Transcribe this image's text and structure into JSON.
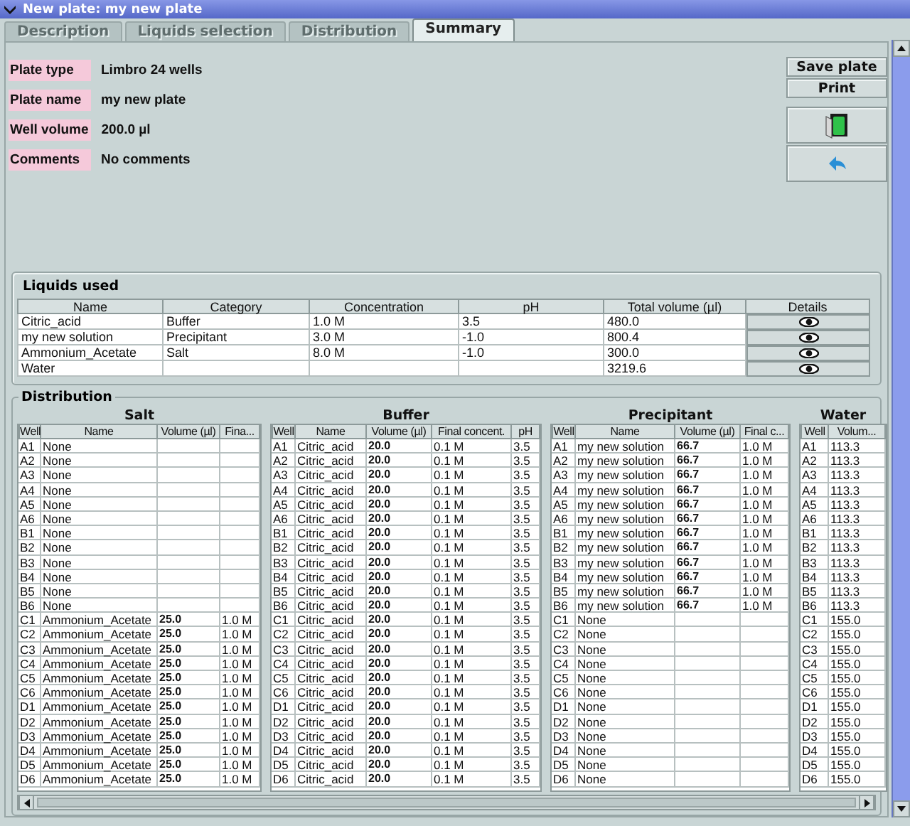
{
  "window": {
    "title": "New plate: my new plate"
  },
  "tabs": [
    {
      "label": "Description",
      "selected": false,
      "disabled": true
    },
    {
      "label": "Liquids selection",
      "selected": false,
      "disabled": true
    },
    {
      "label": "Distribution",
      "selected": false,
      "disabled": true
    },
    {
      "label": "Summary",
      "selected": true,
      "disabled": false
    }
  ],
  "fields": [
    {
      "label": "Plate type",
      "value": "Limbro 24 wells"
    },
    {
      "label": "Plate name",
      "value": "my new plate"
    },
    {
      "label": "Well volume",
      "value": "200.0 µl"
    },
    {
      "label": "Comments",
      "value": "No comments"
    }
  ],
  "buttons": [
    {
      "kind": "text",
      "label": "Save plate"
    },
    {
      "kind": "text",
      "label": "Print"
    },
    {
      "kind": "plate-icon"
    },
    {
      "kind": "back-icon"
    }
  ],
  "liquids_used": {
    "title": "Liquids used",
    "columns": [
      "Name",
      "Category",
      "Concentration",
      "pH",
      "Total volume (µl)",
      "Details"
    ],
    "rows": [
      {
        "name": "Citric_acid",
        "category": "Buffer",
        "concentration": "1.0 M",
        "ph": "3.5",
        "total_volume": "480.0"
      },
      {
        "name": "my new solution",
        "category": "Precipitant",
        "concentration": "3.0 M",
        "ph": "-1.0",
        "total_volume": "800.4"
      },
      {
        "name": "Ammonium_Acetate",
        "category": "Salt",
        "concentration": "8.0 M",
        "ph": "-1.0",
        "total_volume": "300.0"
      },
      {
        "name": "Water",
        "total_volume": "3219.6"
      }
    ]
  },
  "distribution": {
    "title": "Distribution",
    "tables": [
      {
        "title": "Salt",
        "columns": [
          {
            "label": "Well"
          },
          {
            "label": "Name"
          },
          {
            "label": "Volume (µl)",
            "bold": true
          },
          {
            "label": "Fina..."
          }
        ],
        "rows": [
          [
            "A1",
            "None"
          ],
          [
            "A2",
            "None"
          ],
          [
            "A3",
            "None"
          ],
          [
            "A4",
            "None"
          ],
          [
            "A5",
            "None"
          ],
          [
            "A6",
            "None"
          ],
          [
            "B1",
            "None"
          ],
          [
            "B2",
            "None"
          ],
          [
            "B3",
            "None"
          ],
          [
            "B4",
            "None"
          ],
          [
            "B5",
            "None"
          ],
          [
            "B6",
            "None"
          ],
          [
            "C1",
            "Ammonium_Acetate",
            "25.0",
            "1.0 M"
          ],
          [
            "C2",
            "Ammonium_Acetate",
            "25.0",
            "1.0 M"
          ],
          [
            "C3",
            "Ammonium_Acetate",
            "25.0",
            "1.0 M"
          ],
          [
            "C4",
            "Ammonium_Acetate",
            "25.0",
            "1.0 M"
          ],
          [
            "C5",
            "Ammonium_Acetate",
            "25.0",
            "1.0 M"
          ],
          [
            "C6",
            "Ammonium_Acetate",
            "25.0",
            "1.0 M"
          ],
          [
            "D1",
            "Ammonium_Acetate",
            "25.0",
            "1.0 M"
          ],
          [
            "D2",
            "Ammonium_Acetate",
            "25.0",
            "1.0 M"
          ],
          [
            "D3",
            "Ammonium_Acetate",
            "25.0",
            "1.0 M"
          ],
          [
            "D4",
            "Ammonium_Acetate",
            "25.0",
            "1.0 M"
          ],
          [
            "D5",
            "Ammonium_Acetate",
            "25.0",
            "1.0 M"
          ],
          [
            "D6",
            "Ammonium_Acetate",
            "25.0",
            "1.0 M"
          ]
        ]
      },
      {
        "title": "Buffer",
        "columns": [
          {
            "label": "Well"
          },
          {
            "label": "Name"
          },
          {
            "label": "Volume (µl)",
            "bold": true
          },
          {
            "label": "Final concent."
          },
          {
            "label": "pH"
          }
        ],
        "rows": [
          [
            "A1",
            "Citric_acid",
            "20.0",
            "0.1 M",
            "3.5"
          ],
          [
            "A2",
            "Citric_acid",
            "20.0",
            "0.1 M",
            "3.5"
          ],
          [
            "A3",
            "Citric_acid",
            "20.0",
            "0.1 M",
            "3.5"
          ],
          [
            "A4",
            "Citric_acid",
            "20.0",
            "0.1 M",
            "3.5"
          ],
          [
            "A5",
            "Citric_acid",
            "20.0",
            "0.1 M",
            "3.5"
          ],
          [
            "A6",
            "Citric_acid",
            "20.0",
            "0.1 M",
            "3.5"
          ],
          [
            "B1",
            "Citric_acid",
            "20.0",
            "0.1 M",
            "3.5"
          ],
          [
            "B2",
            "Citric_acid",
            "20.0",
            "0.1 M",
            "3.5"
          ],
          [
            "B3",
            "Citric_acid",
            "20.0",
            "0.1 M",
            "3.5"
          ],
          [
            "B4",
            "Citric_acid",
            "20.0",
            "0.1 M",
            "3.5"
          ],
          [
            "B5",
            "Citric_acid",
            "20.0",
            "0.1 M",
            "3.5"
          ],
          [
            "B6",
            "Citric_acid",
            "20.0",
            "0.1 M",
            "3.5"
          ],
          [
            "C1",
            "Citric_acid",
            "20.0",
            "0.1 M",
            "3.5"
          ],
          [
            "C2",
            "Citric_acid",
            "20.0",
            "0.1 M",
            "3.5"
          ],
          [
            "C3",
            "Citric_acid",
            "20.0",
            "0.1 M",
            "3.5"
          ],
          [
            "C4",
            "Citric_acid",
            "20.0",
            "0.1 M",
            "3.5"
          ],
          [
            "C5",
            "Citric_acid",
            "20.0",
            "0.1 M",
            "3.5"
          ],
          [
            "C6",
            "Citric_acid",
            "20.0",
            "0.1 M",
            "3.5"
          ],
          [
            "D1",
            "Citric_acid",
            "20.0",
            "0.1 M",
            "3.5"
          ],
          [
            "D2",
            "Citric_acid",
            "20.0",
            "0.1 M",
            "3.5"
          ],
          [
            "D3",
            "Citric_acid",
            "20.0",
            "0.1 M",
            "3.5"
          ],
          [
            "D4",
            "Citric_acid",
            "20.0",
            "0.1 M",
            "3.5"
          ],
          [
            "D5",
            "Citric_acid",
            "20.0",
            "0.1 M",
            "3.5"
          ],
          [
            "D6",
            "Citric_acid",
            "20.0",
            "0.1 M",
            "3.5"
          ]
        ]
      },
      {
        "title": "Precipitant",
        "columns": [
          {
            "label": "Well"
          },
          {
            "label": "Name"
          },
          {
            "label": "Volume (µl)",
            "bold": true
          },
          {
            "label": "Final c..."
          }
        ],
        "rows": [
          [
            "A1",
            "my new solution",
            "66.7",
            "1.0 M"
          ],
          [
            "A2",
            "my new solution",
            "66.7",
            "1.0 M"
          ],
          [
            "A3",
            "my new solution",
            "66.7",
            "1.0 M"
          ],
          [
            "A4",
            "my new solution",
            "66.7",
            "1.0 M"
          ],
          [
            "A5",
            "my new solution",
            "66.7",
            "1.0 M"
          ],
          [
            "A6",
            "my new solution",
            "66.7",
            "1.0 M"
          ],
          [
            "B1",
            "my new solution",
            "66.7",
            "1.0 M"
          ],
          [
            "B2",
            "my new solution",
            "66.7",
            "1.0 M"
          ],
          [
            "B3",
            "my new solution",
            "66.7",
            "1.0 M"
          ],
          [
            "B4",
            "my new solution",
            "66.7",
            "1.0 M"
          ],
          [
            "B5",
            "my new solution",
            "66.7",
            "1.0 M"
          ],
          [
            "B6",
            "my new solution",
            "66.7",
            "1.0 M"
          ],
          [
            "C1",
            "None"
          ],
          [
            "C2",
            "None"
          ],
          [
            "C3",
            "None"
          ],
          [
            "C4",
            "None"
          ],
          [
            "C5",
            "None"
          ],
          [
            "C6",
            "None"
          ],
          [
            "D1",
            "None"
          ],
          [
            "D2",
            "None"
          ],
          [
            "D3",
            "None"
          ],
          [
            "D4",
            "None"
          ],
          [
            "D5",
            "None"
          ],
          [
            "D6",
            "None"
          ]
        ]
      },
      {
        "title": "Water",
        "columns": [
          {
            "label": "Well"
          },
          {
            "label": "Volum..."
          }
        ],
        "rows": [
          [
            "A1",
            "113.3"
          ],
          [
            "A2",
            "113.3"
          ],
          [
            "A3",
            "113.3"
          ],
          [
            "A4",
            "113.3"
          ],
          [
            "A5",
            "113.3"
          ],
          [
            "A6",
            "113.3"
          ],
          [
            "B1",
            "113.3"
          ],
          [
            "B2",
            "113.3"
          ],
          [
            "B3",
            "113.3"
          ],
          [
            "B4",
            "113.3"
          ],
          [
            "B5",
            "113.3"
          ],
          [
            "B6",
            "113.3"
          ],
          [
            "C1",
            "155.0"
          ],
          [
            "C2",
            "155.0"
          ],
          [
            "C3",
            "155.0"
          ],
          [
            "C4",
            "155.0"
          ],
          [
            "C5",
            "155.0"
          ],
          [
            "C6",
            "155.0"
          ],
          [
            "D1",
            "155.0"
          ],
          [
            "D2",
            "155.0"
          ],
          [
            "D3",
            "155.0"
          ],
          [
            "D4",
            "155.0"
          ],
          [
            "D5",
            "155.0"
          ],
          [
            "D6",
            "155.0"
          ]
        ]
      }
    ]
  }
}
